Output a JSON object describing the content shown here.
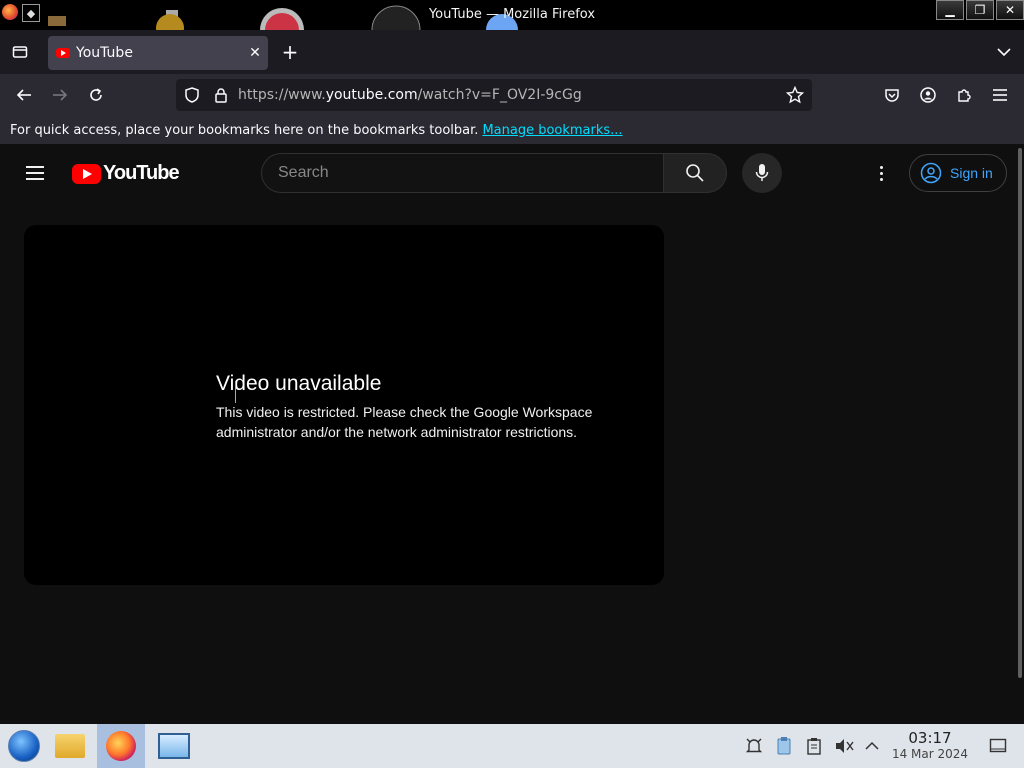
{
  "window": {
    "title": "YouTube — Mozilla Firefox"
  },
  "tab": {
    "title": "YouTube",
    "close_glyph": "✕",
    "new_tab_glyph": "+"
  },
  "urlbar": {
    "prefix": "https://www.",
    "domain": "youtube.com",
    "path": "/watch?v=F_OV2I-9cGg"
  },
  "bookmarks_bar": {
    "message": "For quick access, place your bookmarks here on the bookmarks toolbar.",
    "link": "Manage bookmarks..."
  },
  "youtube": {
    "logo_text": "YouTube",
    "search_placeholder": "Search",
    "sign_in_label": "Sign in"
  },
  "player": {
    "error_title": "Video unavailable",
    "error_message": "This video is restricted. Please check the Google Workspace administrator and/or the network administrator restrictions."
  },
  "taskbar": {
    "time": "03:17",
    "date": "14 Mar 2024"
  },
  "colors": {
    "youtube_red": "#ff0000",
    "link_blue": "#3ea6ff",
    "page_bg": "#0f0f0f"
  }
}
